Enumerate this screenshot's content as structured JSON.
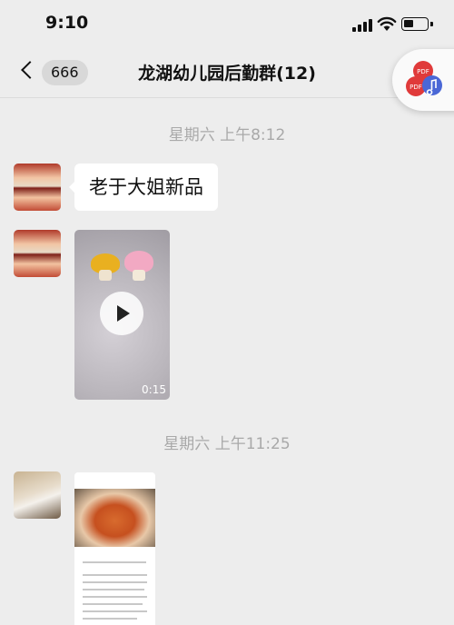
{
  "status_bar": {
    "time": "9:10"
  },
  "nav": {
    "back_badge": "666",
    "title": "龙湖幼儿园后勤群(12)"
  },
  "messages": {
    "timestamp_1": "星期六 上午8:12",
    "text_1": "老于大姐新品",
    "video_duration": "0:15",
    "timestamp_2": "星期六 上午11:25"
  },
  "floating_widget": {
    "label": "PDF"
  }
}
